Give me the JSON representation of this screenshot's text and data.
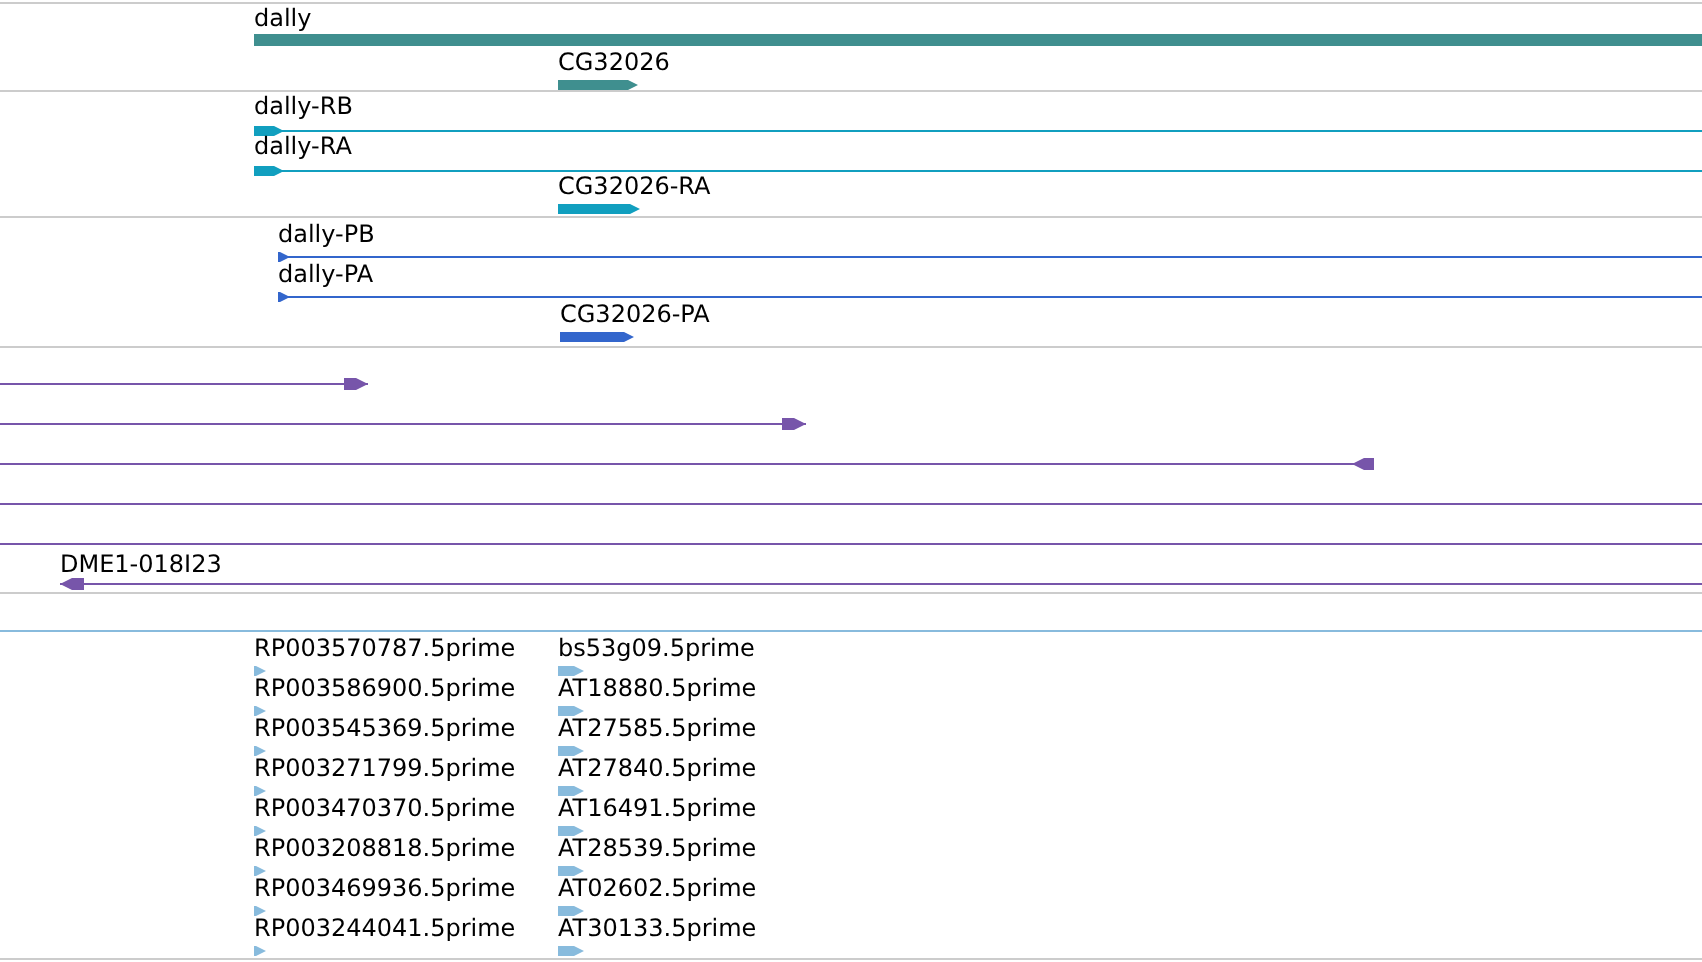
{
  "tracks": [
    {
      "kind": "gene",
      "features": [
        {
          "label": "dally"
        },
        {
          "label": "CG32026",
          "reverse": false
        }
      ]
    },
    {
      "kind": "transcript",
      "features": [
        {
          "label": "dally-RB",
          "reverse": false
        },
        {
          "label": "dally-RA",
          "reverse": false
        },
        {
          "label": "CG32026-RA",
          "reverse": false
        }
      ]
    },
    {
      "kind": "protein",
      "features": [
        {
          "label": "dally-PB",
          "reverse": false
        },
        {
          "label": "dally-PA",
          "reverse": false
        },
        {
          "label": "CG32026-PA",
          "reverse": false
        }
      ]
    },
    {
      "kind": "clone",
      "features": [
        {
          "reverse": false,
          "clipped": false
        },
        {
          "reverse": false,
          "clipped": false
        },
        {
          "reverse": true,
          "clipped": false
        },
        {
          "clipped": true
        },
        {
          "clipped": true
        },
        {
          "label": "DME1-018I23",
          "reverse": true,
          "clipped": false
        }
      ]
    },
    {
      "kind": "empty"
    },
    {
      "kind": "est",
      "columns": [
        {
          "features": [
            {
              "label": "RP003570787.5prime"
            },
            {
              "label": "RP003586900.5prime"
            },
            {
              "label": "RP003545369.5prime"
            },
            {
              "label": "RP003271799.5prime"
            },
            {
              "label": "RP003470370.5prime"
            },
            {
              "label": "RP003208818.5prime"
            },
            {
              "label": "RP003469936.5prime"
            },
            {
              "label": "RP003244041.5prime"
            }
          ]
        },
        {
          "features": [
            {
              "label": "bs53g09.5prime"
            },
            {
              "label": "AT18880.5prime"
            },
            {
              "label": "AT27585.5prime"
            },
            {
              "label": "AT27840.5prime"
            },
            {
              "label": "AT16491.5prime"
            },
            {
              "label": "AT28539.5prime"
            },
            {
              "label": "AT02602.5prime"
            },
            {
              "label": "AT30133.5prime"
            }
          ]
        }
      ]
    }
  ]
}
